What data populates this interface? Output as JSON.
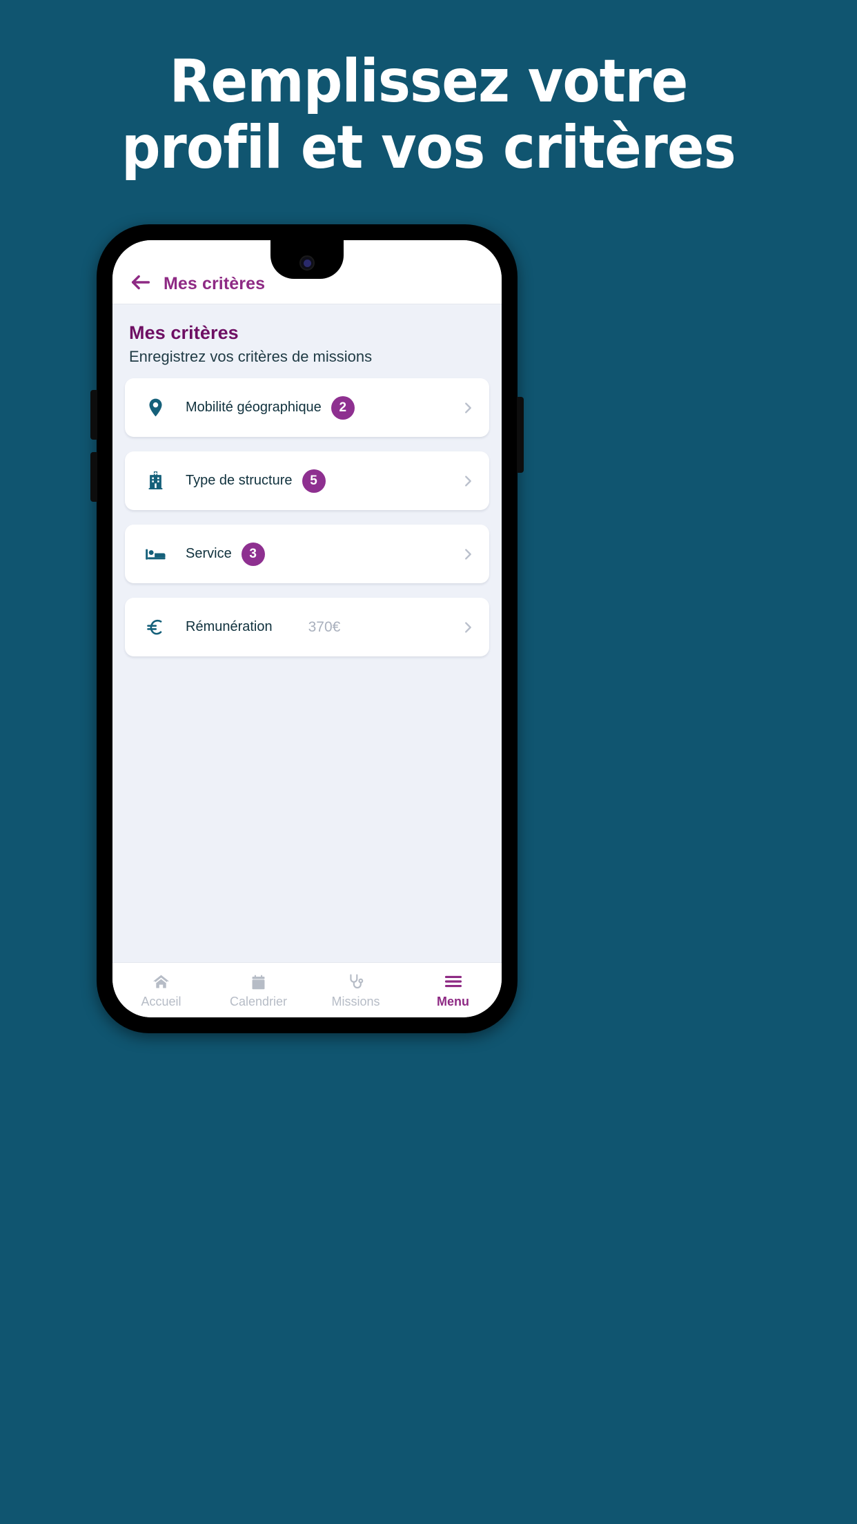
{
  "promo": {
    "headline_line1": "Remplissez votre",
    "headline_line2": "profil et vos critères",
    "background_color": "#105570",
    "headline_color": "#ffffff"
  },
  "app_header": {
    "back_icon": "arrow-left-icon",
    "title": "Mes critères",
    "title_color": "#8E2A84"
  },
  "page": {
    "title": "Mes critères",
    "subtitle": "Enregistrez vos critères de missions",
    "title_color": "#6E0F63",
    "background_color": "#eef1f8"
  },
  "criteria": {
    "accent_color": "#15607A",
    "badge_color": "#8E3090",
    "items": [
      {
        "icon": "location-pin-icon",
        "label": "Mobilité géographique",
        "badge": "2",
        "value": "",
        "chevron": "chevron-right-icon"
      },
      {
        "icon": "hospital-building-icon",
        "label": "Type de structure",
        "badge": "5",
        "value": "",
        "chevron": "chevron-right-icon"
      },
      {
        "icon": "bed-icon",
        "label": "Service",
        "badge": "3",
        "value": "",
        "chevron": "chevron-right-icon"
      },
      {
        "icon": "euro-icon",
        "label": "Rémunération",
        "badge": "",
        "value": "370€",
        "chevron": "chevron-right-icon"
      }
    ]
  },
  "bottom_nav": {
    "active_color": "#8E2A84",
    "inactive_color": "#b6bcc6",
    "items": [
      {
        "icon": "home-icon",
        "label": "Accueil",
        "active": false
      },
      {
        "icon": "calendar-icon",
        "label": "Calendrier",
        "active": false
      },
      {
        "icon": "stethoscope-icon",
        "label": "Missions",
        "active": false
      },
      {
        "icon": "hamburger-menu-icon",
        "label": "Menu",
        "active": true
      }
    ]
  }
}
